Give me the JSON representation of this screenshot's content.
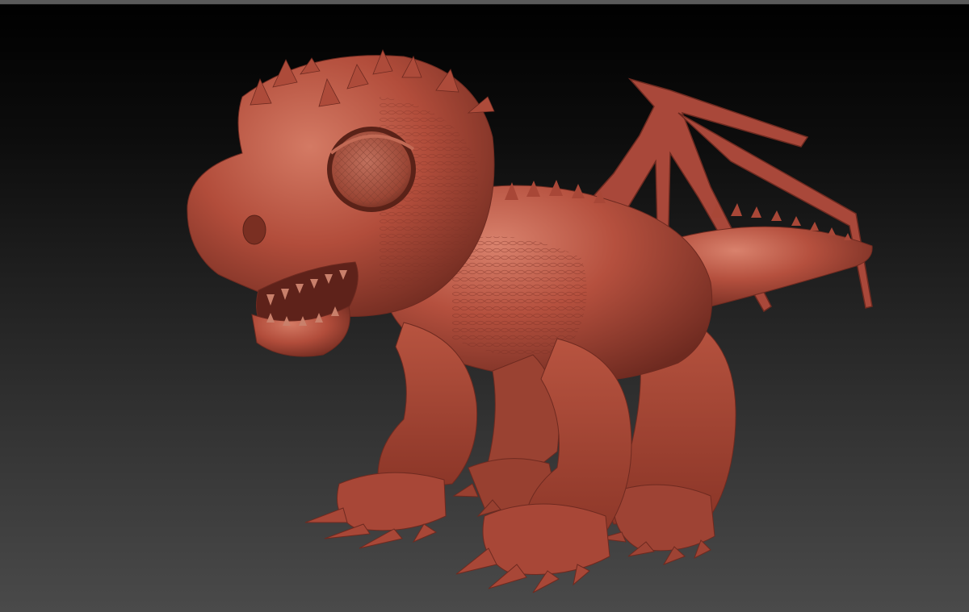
{
  "viewport": {
    "background_top": "#000000",
    "background_bottom": "#4a4a4a",
    "frame_color": "#5a5a5a"
  },
  "model": {
    "subject": "baby-dragon-sculpt",
    "material_color": "#b5503e",
    "highlight_color": "#d9826d",
    "shadow_color": "#6e2a20"
  }
}
